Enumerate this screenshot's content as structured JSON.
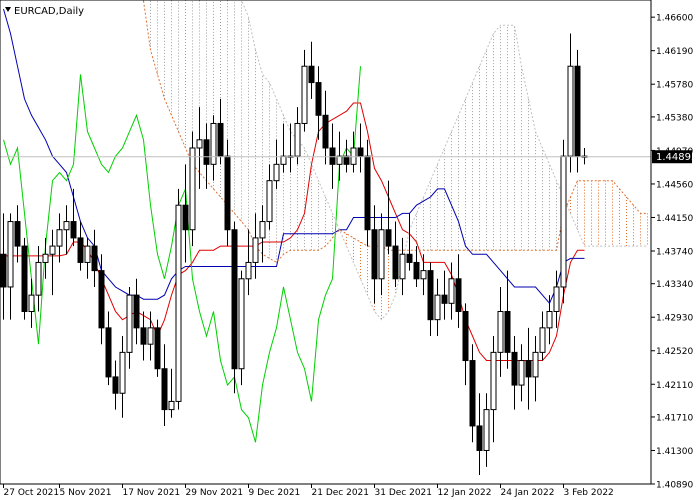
{
  "chart_data": {
    "type": "candlestick",
    "symbol_label": "EURCAD,Daily",
    "current_price": 1.44893,
    "current_price_label": "1.44893",
    "y_range": [
      1.4089,
      1.4681
    ],
    "y_ticks": [
      "1.46600",
      "1.46190",
      "1.45780",
      "1.45380",
      "1.44970",
      "1.44560",
      "1.44150",
      "1.43740",
      "1.43340",
      "1.42930",
      "1.42520",
      "1.42110",
      "1.41710",
      "1.41300",
      "1.40890"
    ],
    "x_ticks": [
      "27 Oct 2021",
      "5 Nov 2021",
      "17 Nov 2021",
      "29 Nov 2021",
      "9 Dec 2021",
      "21 Dec 2021",
      "31 Dec 2021",
      "12 Jan 2022",
      "24 Jan 2022",
      "3 Feb 2022"
    ],
    "x_tick_bars": [
      0,
      8,
      17,
      26,
      35,
      44,
      53,
      62,
      71,
      80
    ],
    "candles": [
      [
        1.437,
        1.442,
        1.429,
        1.433
      ],
      [
        1.433,
        1.442,
        1.429,
        1.441
      ],
      [
        1.441,
        1.443,
        1.436,
        1.438
      ],
      [
        1.438,
        1.439,
        1.429,
        1.43
      ],
      [
        1.43,
        1.434,
        1.428,
        1.432
      ],
      [
        1.432,
        1.438,
        1.43,
        1.436
      ],
      [
        1.436,
        1.439,
        1.434,
        1.437
      ],
      [
        1.437,
        1.44,
        1.432,
        1.438
      ],
      [
        1.438,
        1.442,
        1.436,
        1.44
      ],
      [
        1.44,
        1.443,
        1.437,
        1.441
      ],
      [
        1.441,
        1.445,
        1.438,
        1.439
      ],
      [
        1.439,
        1.441,
        1.435,
        1.436
      ],
      [
        1.436,
        1.439,
        1.434,
        1.438
      ],
      [
        1.438,
        1.44,
        1.433,
        1.435
      ],
      [
        1.435,
        1.437,
        1.426,
        1.428
      ],
      [
        1.428,
        1.43,
        1.421,
        1.422
      ],
      [
        1.422,
        1.424,
        1.418,
        1.42
      ],
      [
        1.42,
        1.427,
        1.417,
        1.425
      ],
      [
        1.425,
        1.433,
        1.423,
        1.432
      ],
      [
        1.432,
        1.434,
        1.426,
        1.428
      ],
      [
        1.428,
        1.43,
        1.424,
        1.426
      ],
      [
        1.426,
        1.43,
        1.424,
        1.428
      ],
      [
        1.428,
        1.429,
        1.422,
        1.423
      ],
      [
        1.423,
        1.426,
        1.416,
        1.418
      ],
      [
        1.418,
        1.423,
        1.417,
        1.419
      ],
      [
        1.419,
        1.445,
        1.418,
        1.443
      ],
      [
        1.443,
        1.448,
        1.436,
        1.44
      ],
      [
        1.44,
        1.452,
        1.438,
        1.45
      ],
      [
        1.45,
        1.455,
        1.445,
        1.451
      ],
      [
        1.451,
        1.453,
        1.445,
        1.448
      ],
      [
        1.448,
        1.454,
        1.446,
        1.453
      ],
      [
        1.453,
        1.456,
        1.448,
        1.449
      ],
      [
        1.449,
        1.451,
        1.438,
        1.44
      ],
      [
        1.44,
        1.441,
        1.42,
        1.423
      ],
      [
        1.423,
        1.435,
        1.421,
        1.434
      ],
      [
        1.434,
        1.44,
        1.432,
        1.436
      ],
      [
        1.436,
        1.442,
        1.434,
        1.439
      ],
      [
        1.439,
        1.443,
        1.436,
        1.441
      ],
      [
        1.441,
        1.448,
        1.44,
        1.446
      ],
      [
        1.446,
        1.451,
        1.445,
        1.448
      ],
      [
        1.448,
        1.453,
        1.447,
        1.449
      ],
      [
        1.449,
        1.453,
        1.447,
        1.449
      ],
      [
        1.449,
        1.455,
        1.448,
        1.453
      ],
      [
        1.453,
        1.462,
        1.452,
        1.46
      ],
      [
        1.46,
        1.463,
        1.456,
        1.458
      ],
      [
        1.458,
        1.46,
        1.451,
        1.454
      ],
      [
        1.454,
        1.457,
        1.448,
        1.45
      ],
      [
        1.45,
        1.453,
        1.445,
        1.448
      ],
      [
        1.448,
        1.452,
        1.446,
        1.449
      ],
      [
        1.449,
        1.451,
        1.447,
        1.448
      ],
      [
        1.448,
        1.452,
        1.447,
        1.45
      ],
      [
        1.45,
        1.453,
        1.447,
        1.449
      ],
      [
        1.449,
        1.451,
        1.438,
        1.44
      ],
      [
        1.44,
        1.443,
        1.431,
        1.434
      ],
      [
        1.434,
        1.442,
        1.432,
        1.44
      ],
      [
        1.44,
        1.446,
        1.437,
        1.438
      ],
      [
        1.438,
        1.441,
        1.433,
        1.434
      ],
      [
        1.434,
        1.439,
        1.432,
        1.437
      ],
      [
        1.437,
        1.442,
        1.435,
        1.436
      ],
      [
        1.436,
        1.438,
        1.433,
        1.434
      ],
      [
        1.434,
        1.437,
        1.432,
        1.435
      ],
      [
        1.435,
        1.436,
        1.427,
        1.429
      ],
      [
        1.429,
        1.434,
        1.427,
        1.432
      ],
      [
        1.432,
        1.435,
        1.429,
        1.431
      ],
      [
        1.431,
        1.436,
        1.429,
        1.434
      ],
      [
        1.434,
        1.437,
        1.428,
        1.43
      ],
      [
        1.43,
        1.431,
        1.421,
        1.424
      ],
      [
        1.424,
        1.426,
        1.414,
        1.416
      ],
      [
        1.416,
        1.42,
        1.41,
        1.413
      ],
      [
        1.413,
        1.42,
        1.411,
        1.418
      ],
      [
        1.418,
        1.427,
        1.414,
        1.425
      ],
      [
        1.425,
        1.433,
        1.422,
        1.43
      ],
      [
        1.43,
        1.435,
        1.423,
        1.425
      ],
      [
        1.425,
        1.427,
        1.418,
        1.421
      ],
      [
        1.421,
        1.426,
        1.419,
        1.424
      ],
      [
        1.424,
        1.428,
        1.418,
        1.422
      ],
      [
        1.422,
        1.427,
        1.419,
        1.425
      ],
      [
        1.425,
        1.43,
        1.424,
        1.428
      ],
      [
        1.428,
        1.432,
        1.426,
        1.43
      ],
      [
        1.43,
        1.435,
        1.428,
        1.433
      ],
      [
        1.433,
        1.451,
        1.431,
        1.449
      ],
      [
        1.449,
        1.464,
        1.447,
        1.46
      ],
      [
        1.46,
        1.462,
        1.447,
        1.449
      ],
      [
        1.449,
        1.45,
        1.448,
        1.4489
      ]
    ],
    "series": [
      {
        "role": "tenkan",
        "color": "#e00000",
        "values": [
          1.4368,
          1.4368,
          1.4368,
          1.4368,
          1.4368,
          1.4368,
          1.4368,
          1.4368,
          1.4368,
          1.437,
          1.4385,
          1.4385,
          1.4375,
          1.436,
          1.434,
          1.432,
          1.43,
          1.429,
          1.4295,
          1.43,
          1.4295,
          1.429,
          1.427,
          1.429,
          1.432,
          1.4345,
          1.435,
          1.436,
          1.4375,
          1.4375,
          1.4375,
          1.438,
          1.438,
          1.438,
          1.438,
          1.438,
          1.438,
          1.4385,
          1.4385,
          1.4385,
          1.4385,
          1.439,
          1.44,
          1.442,
          1.448,
          1.452,
          1.453,
          1.4535,
          1.454,
          1.4545,
          1.4555,
          1.4555,
          1.452,
          1.4475,
          1.446,
          1.444,
          1.442,
          1.44,
          1.4395,
          1.4385,
          1.436,
          1.436,
          1.436,
          1.436,
          1.4345,
          1.432,
          1.429,
          1.427,
          1.425,
          1.424,
          1.424,
          1.424,
          1.424,
          1.424,
          1.424,
          1.424,
          1.424,
          1.424,
          1.425,
          1.427,
          1.432,
          1.436,
          1.4375,
          1.4375
        ]
      },
      {
        "role": "kijun",
        "color": "#0000b0",
        "values": [
          1.467,
          1.464,
          1.46,
          1.456,
          1.454,
          1.4525,
          1.451,
          1.449,
          1.448,
          1.447,
          1.444,
          1.441,
          1.439,
          1.438,
          1.435,
          1.434,
          1.433,
          1.4325,
          1.432,
          1.432,
          1.4315,
          1.4315,
          1.4315,
          1.432,
          1.434,
          1.435,
          1.4355,
          1.4355,
          1.4355,
          1.4355,
          1.4355,
          1.4355,
          1.4355,
          1.4355,
          1.4355,
          1.4355,
          1.4355,
          1.4355,
          1.4355,
          1.4355,
          1.4395,
          1.4395,
          1.4395,
          1.4395,
          1.4395,
          1.4395,
          1.4395,
          1.4395,
          1.44,
          1.44,
          1.4415,
          1.4415,
          1.4415,
          1.4415,
          1.4415,
          1.4415,
          1.4415,
          1.442,
          1.442,
          1.443,
          1.4435,
          1.444,
          1.445,
          1.445,
          1.443,
          1.441,
          1.438,
          1.437,
          1.437,
          1.437,
          1.436,
          1.435,
          1.434,
          1.433,
          1.433,
          1.433,
          1.433,
          1.432,
          1.431,
          1.433,
          1.436,
          1.4365,
          1.4365,
          1.4365
        ]
      },
      {
        "role": "chikou",
        "color": "#00d000",
        "values": [
          1.451,
          1.448,
          1.45,
          1.442,
          1.434,
          1.426,
          1.438,
          1.446,
          1.447,
          1.446,
          1.448,
          1.459,
          1.452,
          1.45,
          1.448,
          1.447,
          1.449,
          1.45,
          1.452,
          1.454,
          1.451,
          1.443,
          1.437,
          1.434,
          1.438,
          1.443,
          1.445,
          1.434,
          1.43,
          1.427,
          1.43,
          1.424,
          1.421,
          1.422,
          1.418,
          1.417,
          1.414,
          1.421,
          1.425,
          1.428,
          1.433,
          1.429,
          1.425,
          1.423,
          1.419,
          1.429,
          1.432,
          1.434,
          1.448,
          1.45,
          1.449,
          1.46,
          null,
          null,
          null,
          null,
          null,
          null,
          null,
          null,
          null,
          null,
          null,
          null,
          null,
          null,
          null,
          null,
          null,
          null,
          null,
          null,
          null,
          null,
          null,
          null,
          null,
          null,
          null,
          null,
          null,
          null,
          null,
          null
        ]
      },
      {
        "role": "senkou_a",
        "color": "#e07030",
        "values": [
          null,
          null,
          null,
          null,
          null,
          null,
          null,
          null,
          null,
          null,
          null,
          null,
          null,
          null,
          null,
          null,
          null,
          null,
          null,
          null,
          1.468,
          1.462,
          1.459,
          1.456,
          1.454,
          1.452,
          1.45,
          1.448,
          1.447,
          1.446,
          1.445,
          1.444,
          1.443,
          1.442,
          1.441,
          1.44,
          1.438,
          1.437,
          1.4365,
          1.436,
          1.437,
          1.4375,
          1.4375,
          1.4375,
          1.4375,
          1.4375,
          1.438,
          1.439,
          1.44,
          1.4395,
          1.439,
          1.4385,
          1.438,
          1.438,
          1.438,
          1.4375,
          1.4375,
          1.4375,
          1.4375,
          1.4375,
          1.4375,
          1.4375,
          1.4375,
          1.4375,
          1.4375,
          1.4375,
          1.4375,
          1.4375,
          1.4375,
          1.4375,
          1.4375,
          1.4375,
          1.4375,
          1.4375,
          1.4375,
          1.4375,
          1.4375,
          1.4375,
          1.4375,
          1.4375,
          1.442,
          1.444,
          1.446,
          1.446,
          1.446,
          1.446,
          1.446,
          1.446,
          1.445,
          1.444,
          1.443,
          1.442,
          1.442,
          1.442,
          1.442,
          1.441
        ]
      },
      {
        "role": "senkou_b",
        "color": "#c0c0c0",
        "values": [
          null,
          null,
          null,
          null,
          null,
          null,
          null,
          null,
          null,
          null,
          null,
          null,
          null,
          null,
          null,
          null,
          null,
          null,
          null,
          null,
          1.4681,
          1.4681,
          1.4681,
          1.4681,
          1.4681,
          1.4681,
          1.4681,
          1.4681,
          1.4681,
          1.4681,
          1.4681,
          1.4681,
          1.4681,
          1.4681,
          1.4681,
          1.466,
          1.462,
          1.459,
          1.458,
          1.456,
          1.454,
          1.452,
          1.451,
          1.45,
          1.448,
          1.446,
          1.444,
          1.442,
          1.44,
          1.438,
          1.436,
          1.434,
          1.432,
          1.43,
          1.429,
          1.43,
          1.432,
          1.436,
          1.44,
          1.442,
          1.444,
          1.446,
          1.448,
          1.45,
          1.452,
          1.454,
          1.456,
          1.458,
          1.46,
          1.462,
          1.464,
          1.465,
          1.465,
          1.465,
          1.46,
          1.456,
          1.452,
          1.45,
          1.448,
          1.446,
          1.444,
          1.442,
          1.44,
          1.438,
          1.438,
          1.438,
          1.438,
          1.438,
          1.438,
          1.438,
          1.438,
          1.438,
          1.438,
          1.438,
          1.438,
          1.438
        ]
      }
    ],
    "grid": false,
    "colors": {
      "background": "#ffffff",
      "axis": "#000000",
      "bull_candle": "#ffffff",
      "bear_candle": "#000000",
      "price_line": "#c0c0c0",
      "price_tag": "#000000",
      "cloud_a": "#e07030",
      "cloud_b": "#a0a0a0"
    }
  }
}
